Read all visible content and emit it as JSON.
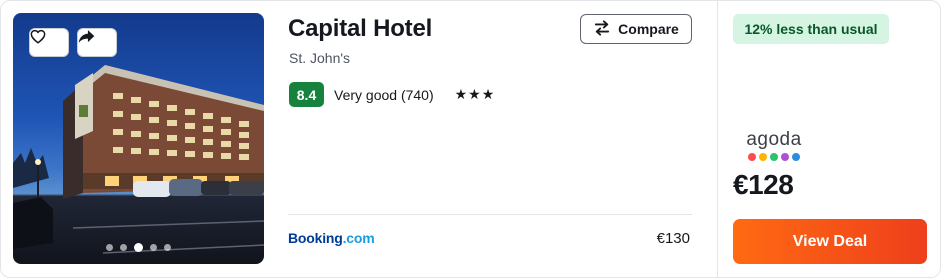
{
  "hotel": {
    "name": "Capital Hotel",
    "location": "St. John's",
    "stars": "★★★",
    "rating": {
      "score": "8.4",
      "text": "Very good (740)"
    }
  },
  "photo": {
    "dot_count": 5,
    "active_dot": 3,
    "favorite_icon": "heart-outline-icon",
    "share_icon": "share-arrow-icon"
  },
  "compare": {
    "label": "Compare",
    "icon": "compare-arrows-icon"
  },
  "provider": {
    "name_main": "Booking",
    "name_suffix": ".com",
    "price": "€130"
  },
  "deal": {
    "badge": "12% less than usual",
    "provider_logo": "agoda",
    "logo_dot_colors": [
      "#ff4b4b",
      "#ffb300",
      "#29c46b",
      "#b04fd6",
      "#2c8ce0"
    ],
    "price": "€128",
    "button": "View Deal"
  },
  "colors": {
    "score_green": "#16823d",
    "badge_bg": "#d5f4e2",
    "badge_text": "#08582c",
    "cta_start": "#ff6a12",
    "cta_end": "#ee3f1c",
    "booking_blue": "#003b95"
  }
}
